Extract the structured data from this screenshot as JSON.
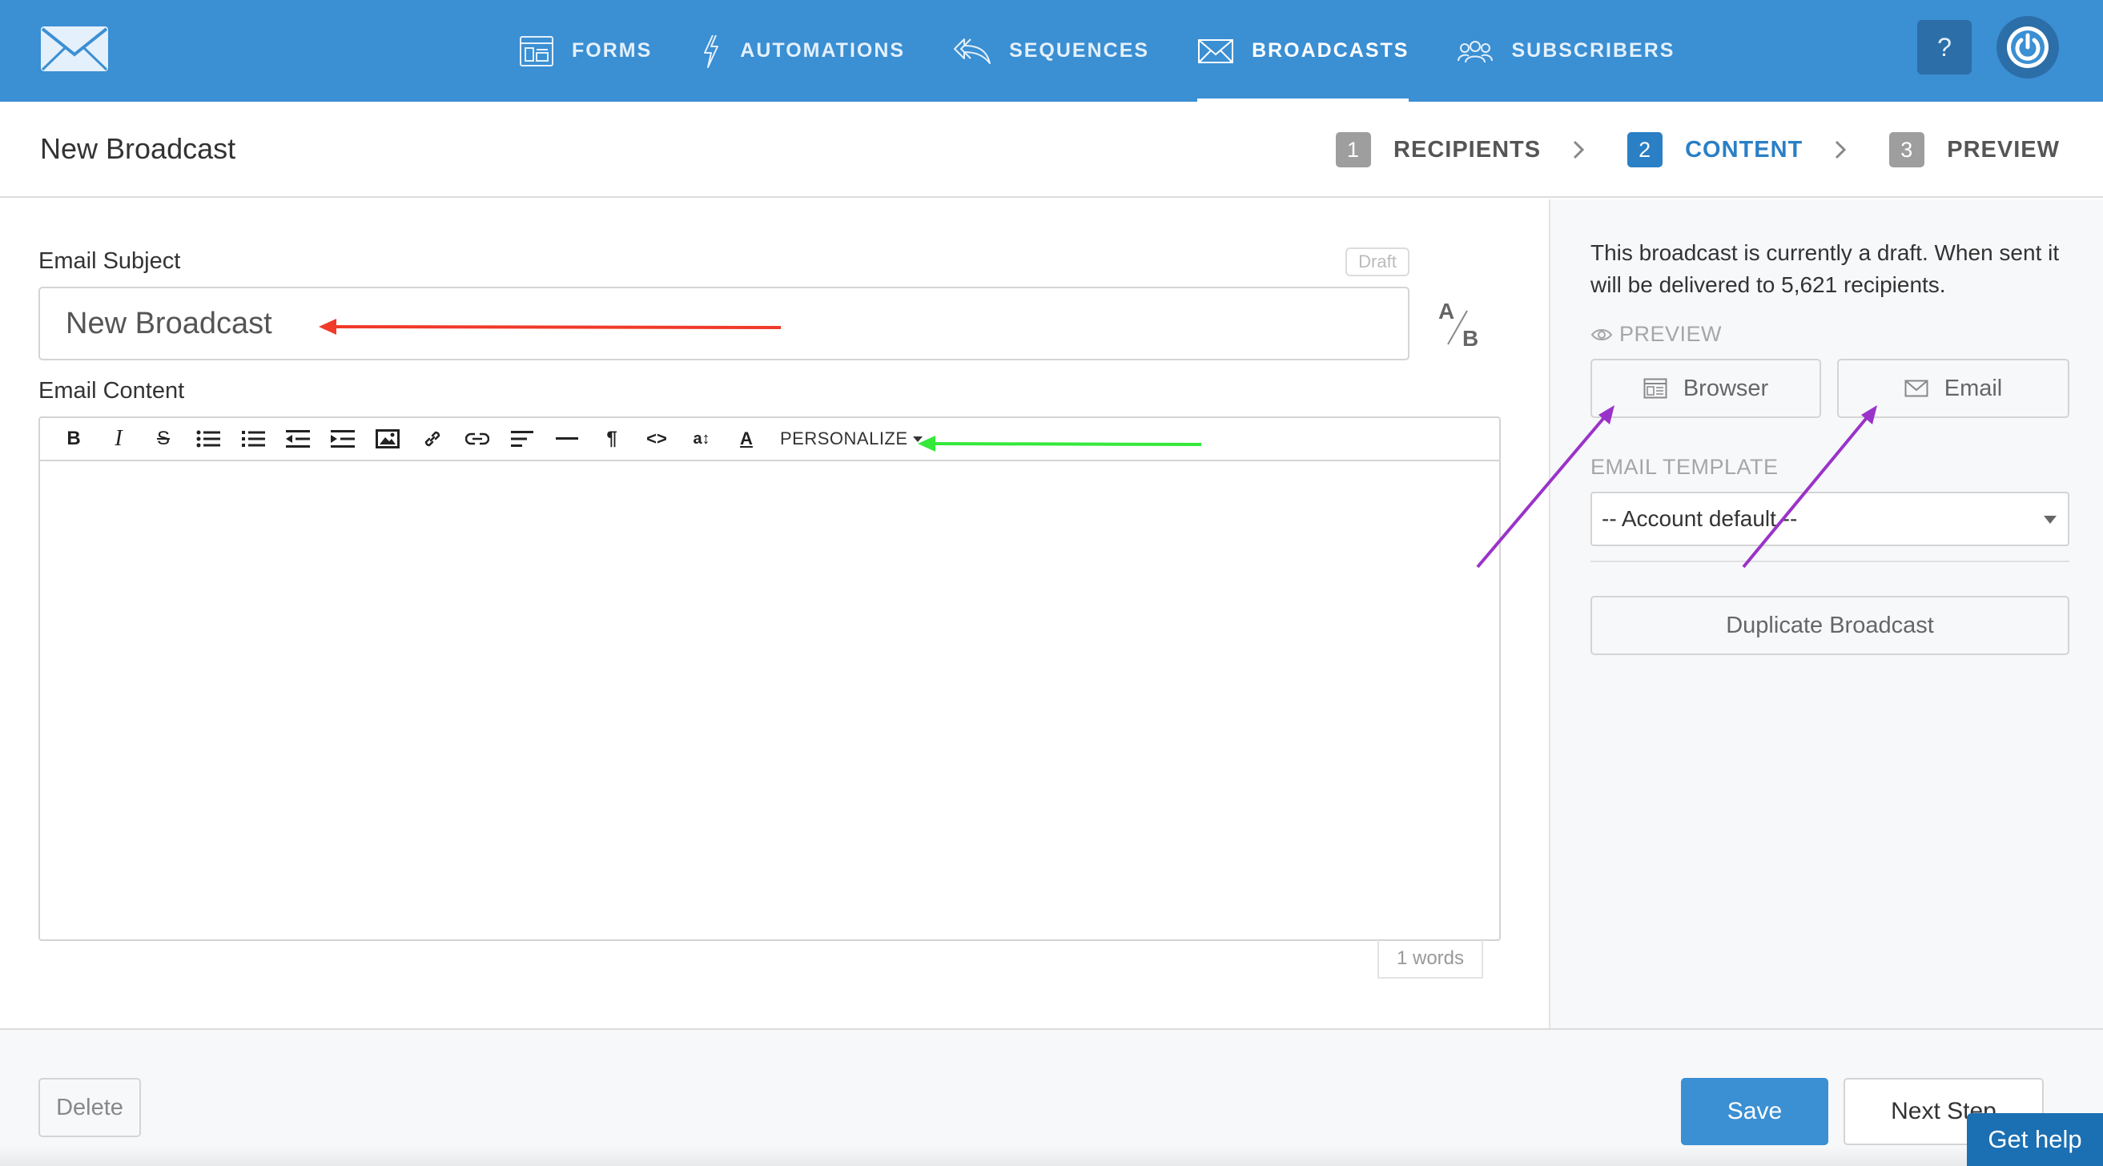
{
  "nav": {
    "items": [
      {
        "label": "FORMS",
        "icon": "forms-icon",
        "active": false
      },
      {
        "label": "AUTOMATIONS",
        "icon": "lightning-icon",
        "active": false
      },
      {
        "label": "SEQUENCES",
        "icon": "sequences-icon",
        "active": false
      },
      {
        "label": "BROADCASTS",
        "icon": "envelope-icon",
        "active": true
      },
      {
        "label": "SUBSCRIBERS",
        "icon": "people-icon",
        "active": false
      }
    ],
    "help_label": "?",
    "brand_color": "#3b8fd3"
  },
  "header": {
    "title": "New Broadcast",
    "steps": [
      {
        "num": "1",
        "label": "RECIPIENTS",
        "active": false
      },
      {
        "num": "2",
        "label": "CONTENT",
        "active": true
      },
      {
        "num": "3",
        "label": "PREVIEW",
        "active": false
      }
    ],
    "active_color": "#2a7fc5"
  },
  "editor": {
    "subject_label": "Email Subject",
    "draft_badge": "Draft",
    "subject_value": "New Broadcast",
    "ab_label_a": "A",
    "ab_label_b": "B",
    "content_label": "Email Content",
    "toolbar": {
      "personalize_label": "PERSONALIZE",
      "buttons": [
        "bold-icon",
        "italic-icon",
        "strikethrough-icon",
        "bullet-list-icon",
        "numbered-list-icon",
        "outdent-icon",
        "indent-icon",
        "image-icon",
        "link-icon",
        "unlink-icon",
        "align-left-icon",
        "horizontal-rule-icon",
        "paragraph-icon",
        "code-icon",
        "font-size-icon",
        "text-color-icon"
      ],
      "bold": "B",
      "italic": "I",
      "strike": "S",
      "paragraph": "¶",
      "code": "<>",
      "text_color": "A",
      "font_size": "a↕"
    },
    "word_count": "1 words"
  },
  "sidebar": {
    "draft_note": "This broadcast is currently a draft. When sent it will be delivered to 5,621 recipients.",
    "preview_label": "PREVIEW",
    "browser_button": "Browser",
    "email_button": "Email",
    "template_label": "EMAIL TEMPLATE",
    "template_selected": "-- Account default --",
    "duplicate_button": "Duplicate Broadcast"
  },
  "footer": {
    "delete_label": "Delete",
    "save_label": "Save",
    "next_label": "Next Step",
    "get_help_label": "Get help"
  },
  "annotations": {
    "red_arrow_color": "#f03a2a",
    "green_arrow_color": "#35e83a",
    "purple_arrow_color": "#9a33c9"
  }
}
